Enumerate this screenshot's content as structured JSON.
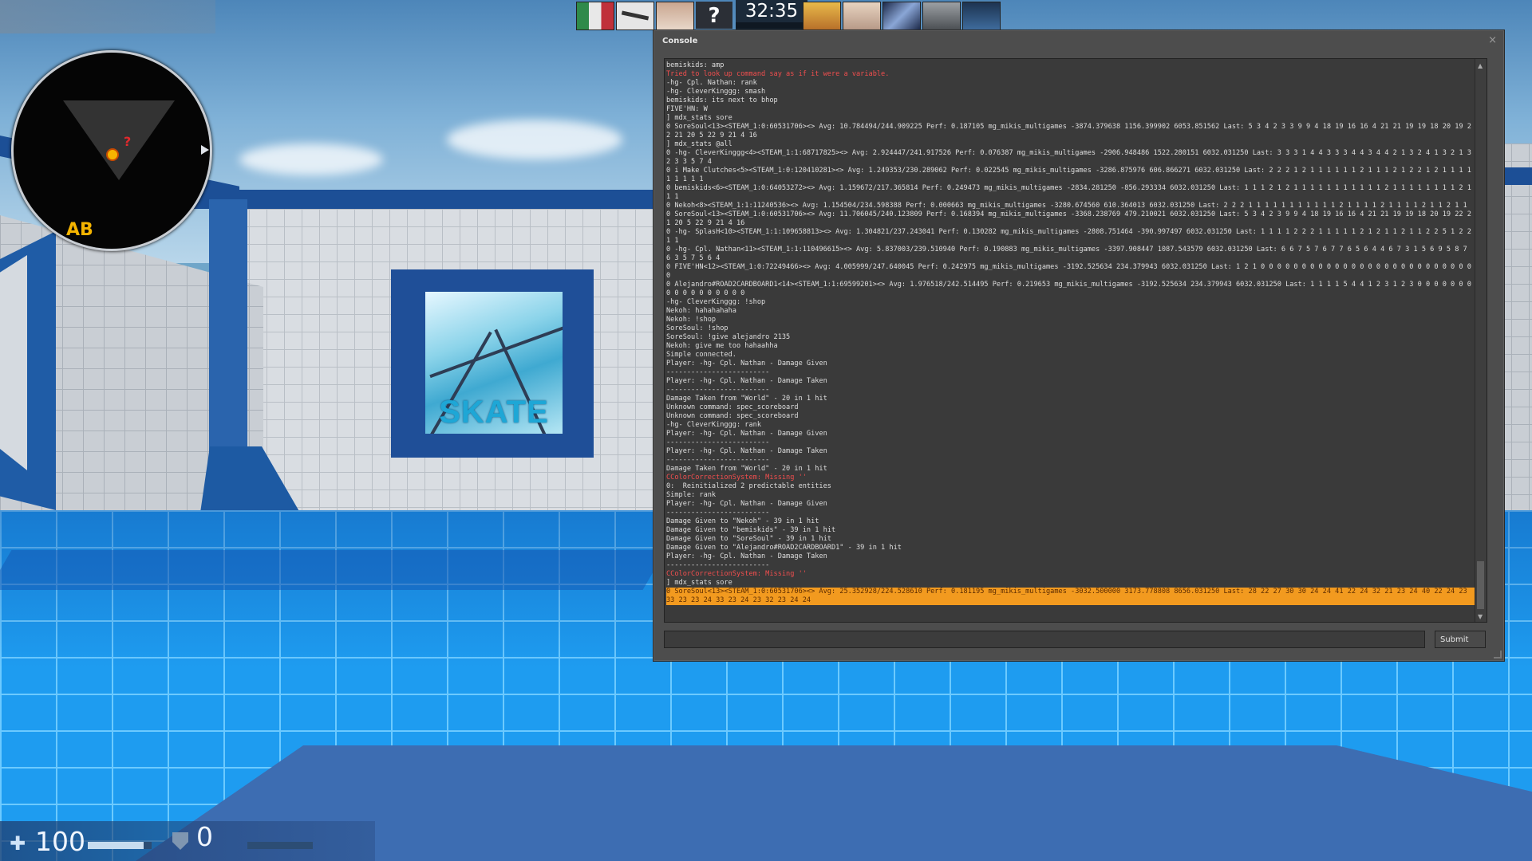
{
  "hud": {
    "health": "100",
    "health_fraction": 0.88,
    "armor": "0",
    "armor_fraction": 0,
    "timer": "32:35",
    "radar_bomb_label": "AB",
    "radar_unknown": "?"
  },
  "map": {
    "window_sign": "SKATE"
  },
  "topbar": {
    "players": [
      "player-1",
      "player-2",
      "player-3",
      "player-unknown",
      "player-4",
      "player-5",
      "player-6",
      "player-7",
      "player-8"
    ],
    "unknown_label": "?"
  },
  "console": {
    "title": "Console",
    "close_glyph": "×",
    "submit_label": "Submit",
    "input_value": "",
    "lines": [
      {
        "text": "bemiskids: amp",
        "type": "normal"
      },
      {
        "text": "Tried to look up command say as if it were a variable.",
        "type": "error"
      },
      {
        "text": "-hg- Cpl. Nathan: rank",
        "type": "normal"
      },
      {
        "text": "-hg- CleverKinggg: smash",
        "type": "normal"
      },
      {
        "text": "bemiskids: its next to bhop",
        "type": "normal"
      },
      {
        "text": "FIVE'HN: W",
        "type": "normal"
      },
      {
        "text": "] mdx_stats sore",
        "type": "normal"
      },
      {
        "text": "0 SoreSoul<13><STEAM_1:0:60531706><> Avg: 10.784494/244.909225 Perf: 0.187105 mg_mikis_multigames -3874.379638 1156.399902 6053.851562 Last: 5 3 4 2 3 3 9 9 4 18 19 16 16 4 21 21 19 19 18 20 19 22 21 20 5 22 9 21 4 16",
        "type": "normal"
      },
      {
        "text": "] mdx_stats @all",
        "type": "normal"
      },
      {
        "text": "0 -hg- CleverKinggg<4><STEAM_1:1:68717825><> Avg: 2.924447/241.917526 Perf: 0.076387 mg_mikis_multigames -2906.948486 1522.280151 6032.031250 Last: 3 3 3 1 4 4 3 3 3 4 4 3 4 4 2 1 3 2 4 1 3 2 1 3 2 3 3 5 7 4",
        "type": "normal"
      },
      {
        "text": "0 i Make Clutches<5><STEAM_1:0:120410281><> Avg: 1.249353/230.289062 Perf: 0.022545 mg_mikis_multigames -3286.875976 606.866271 6032.031250 Last: 2 2 2 1 2 1 1 1 1 1 1 2 1 1 1 2 1 2 2 1 2 1 1 1 1 1 1 1 1 1",
        "type": "normal"
      },
      {
        "text": "0 bemiskids<6><STEAM_1:0:64053272><> Avg: 1.159672/217.365814 Perf: 0.249473 mg_mikis_multigames -2834.281250 -856.293334 6032.031250 Last: 1 1 1 2 1 2 1 1 1 1 1 1 1 1 1 1 1 2 1 1 1 1 1 1 1 1 2 1 1 1",
        "type": "normal"
      },
      {
        "text": "0 Nekoh<8><STEAM_1:1:11240536><> Avg: 1.154504/234.598388 Perf: 0.000663 mg_mikis_multigames -3280.674560 610.364013 6032.031250 Last: 2 2 2 1 1 1 1 1 1 1 1 1 1 1 2 1 1 1 1 2 1 1 1 1 2 1 1 2 1 1",
        "type": "normal"
      },
      {
        "text": "0 SoreSoul<13><STEAM_1:0:60531706><> Avg: 11.706045/240.123809 Perf: 0.168394 mg_mikis_multigames -3368.238769 479.210021 6032.031250 Last: 5 3 4 2 3 9 9 4 18 19 16 16 4 21 21 19 19 18 20 19 22 21 20 5 22 9 21 4 16",
        "type": "normal"
      },
      {
        "text": "0 -hg- SplasH<10><STEAM_1:1:109658813><> Avg: 1.304821/237.243041 Perf: 0.130282 mg_mikis_multigames -2808.751464 -390.997497 6032.031250 Last: 1 1 1 1 2 2 2 1 1 1 1 1 2 1 2 1 1 2 1 1 2 2 5 1 2 2 1 1",
        "type": "normal"
      },
      {
        "text": "0 -hg- Cpl. Nathan<11><STEAM_1:1:110496615><> Avg: 5.837003/239.510940 Perf: 0.190883 mg_mikis_multigames -3397.908447 1087.543579 6032.031250 Last: 6 6 7 5 7 6 7 7 6 5 6 4 4 6 7 3 1 5 6 9 5 8 7 6 3 5 7 5 6 4",
        "type": "normal"
      },
      {
        "text": "0 FIVE'HN<12><STEAM_1:0:72249466><> Avg: 4.005999/247.640045 Perf: 0.242975 mg_mikis_multigames -3192.525634 234.379943 6032.031250 Last: 1 2 1 0 0 0 0 0 0 0 0 0 0 0 0 0 0 0 0 0 0 0 0 0 0 0 0 0 0 0",
        "type": "normal"
      },
      {
        "text": "0 Alejandro#ROAD2CARDBOARD1<14><STEAM_1:1:69599201><> Avg: 1.976518/242.514495 Perf: 0.219653 mg_mikis_multigames -3192.525634 234.379943 6032.031250 Last: 1 1 1 1 5 4 4 1 2 3 1 2 3 0 0 0 0 0 0 0 0 0 0 0 0 0 0 0 0 0",
        "type": "normal"
      },
      {
        "text": "-hg- CleverKinggg: !shop",
        "type": "normal"
      },
      {
        "text": "Nekoh: hahahahaha",
        "type": "normal"
      },
      {
        "text": "Nekoh: !shop",
        "type": "normal"
      },
      {
        "text": "SoreSoul: !shop",
        "type": "normal"
      },
      {
        "text": "SoreSoul: !give alejandro 2135",
        "type": "normal"
      },
      {
        "text": "Nekoh: give me too hahaahha",
        "type": "normal"
      },
      {
        "text": "Simple connected.",
        "type": "normal"
      },
      {
        "text": "Player: -hg- Cpl. Nathan - Damage Given",
        "type": "normal"
      },
      {
        "text": "-------------------------",
        "type": "normal"
      },
      {
        "text": "Player: -hg- Cpl. Nathan - Damage Taken",
        "type": "normal"
      },
      {
        "text": "-------------------------",
        "type": "normal"
      },
      {
        "text": "Damage Taken from \"World\" - 20 in 1 hit",
        "type": "normal"
      },
      {
        "text": "Unknown command: spec_scoreboard",
        "type": "normal"
      },
      {
        "text": "Unknown command: spec_scoreboard",
        "type": "normal"
      },
      {
        "text": "-hg- CleverKinggg: rank",
        "type": "normal"
      },
      {
        "text": "Player: -hg- Cpl. Nathan - Damage Given",
        "type": "normal"
      },
      {
        "text": "-------------------------",
        "type": "normal"
      },
      {
        "text": "Player: -hg- Cpl. Nathan - Damage Taken",
        "type": "normal"
      },
      {
        "text": "-------------------------",
        "type": "normal"
      },
      {
        "text": "Damage Taken from \"World\" - 20 in 1 hit",
        "type": "normal"
      },
      {
        "text": "CColorCorrectionSystem: Missing ''",
        "type": "error"
      },
      {
        "text": "0:  Reinitialized 2 predictable entities",
        "type": "normal"
      },
      {
        "text": "Simple: rank",
        "type": "normal"
      },
      {
        "text": "Player: -hg- Cpl. Nathan - Damage Given",
        "type": "normal"
      },
      {
        "text": "-------------------------",
        "type": "normal"
      },
      {
        "text": "Damage Given to \"Nekoh\" - 39 in 1 hit",
        "type": "normal"
      },
      {
        "text": "Damage Given to \"bemiskids\" - 39 in 1 hit",
        "type": "normal"
      },
      {
        "text": "Damage Given to \"SoreSoul\" - 39 in 1 hit",
        "type": "normal"
      },
      {
        "text": "Damage Given to \"Alejandro#ROAD2CARDBOARD1\" - 39 in 1 hit",
        "type": "normal"
      },
      {
        "text": "Player: -hg- Cpl. Nathan - Damage Taken",
        "type": "normal"
      },
      {
        "text": "-------------------------",
        "type": "normal"
      },
      {
        "text": "CColorCorrectionSystem: Missing ''",
        "type": "error"
      },
      {
        "text": "] mdx_stats sore",
        "type": "normal"
      },
      {
        "text": "0 SoreSoul<13><STEAM_1:0:60531706><> Avg: 25.352928/224.528610 Perf: 0.181195 mg_mikis_multigames -3032.500000 3173.778808 8656.031250 Last: 28 22 27 30 30 24 24 41 22 24 32 21 23 24 40 22 24 23 33 23 23 24 33 23 24 23 32 23 24 24",
        "type": "highlight"
      }
    ]
  },
  "colors": {
    "console_bg": "#4d4d4d",
    "log_bg": "#3a3a3a",
    "error_text": "#f14e4e",
    "highlight_bg": "#f29a1f",
    "floor": "#1e9cf0",
    "trim": "#1c4f96"
  }
}
